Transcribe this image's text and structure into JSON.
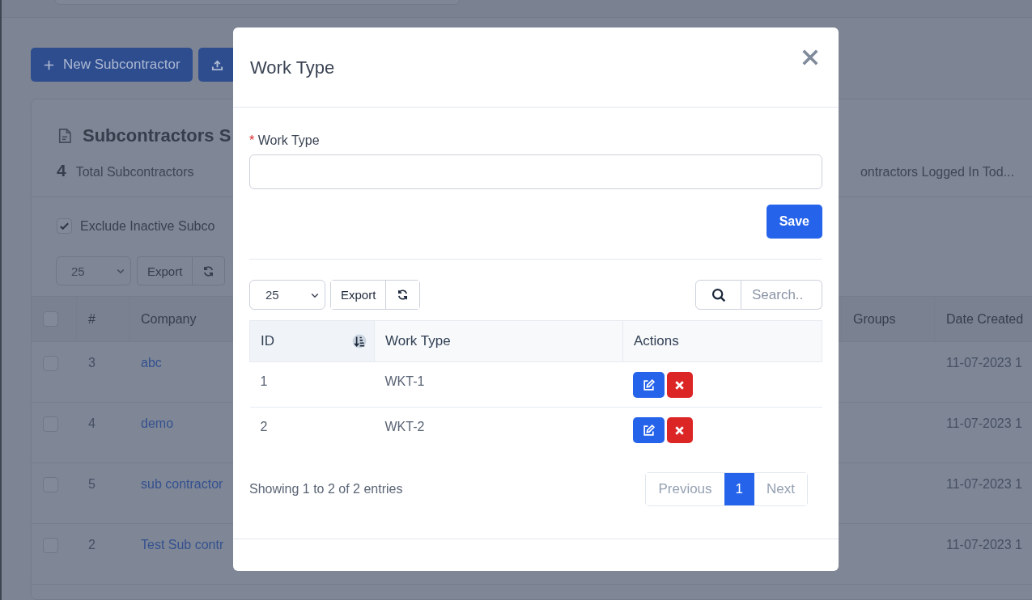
{
  "background_page": {
    "toolbar_buttons": [
      {
        "kind": "add",
        "label": "New Subcontractor"
      },
      {
        "kind": "upload"
      }
    ],
    "summary": {
      "title": "Subcontractors S",
      "total": {
        "count": "4",
        "label": "Total Subcontractors"
      },
      "other_stat": "ontractors Logged In Tod..."
    },
    "filter": {
      "label": "Exclude Inactive Subco",
      "checked": true
    },
    "page_size": "25",
    "export": "Export",
    "table": {
      "select_all": false,
      "columns": [
        "#",
        "Company",
        "Groups",
        "Date Created"
      ],
      "rows": [
        {
          "checked": false,
          "number": "3",
          "company": "abc",
          "date_created": "11-07-2023 1"
        },
        {
          "checked": false,
          "number": "4",
          "company": "demo",
          "date_created": "11-07-2023 1"
        },
        {
          "checked": false,
          "number": "5",
          "company": "sub contractor",
          "date_created": "11-07-2023 1"
        },
        {
          "checked": false,
          "number": "2",
          "company": "Test Sub contr",
          "date_created": "11-07-2023 1"
        }
      ]
    }
  },
  "modal": {
    "title": "Work Type",
    "field": {
      "required_mark": "*",
      "label": "Work Type"
    },
    "save": "Save",
    "page_size": "25",
    "export": "Export",
    "search": {
      "placeholder": "Search.."
    },
    "table": {
      "columns": [
        {
          "label": "ID",
          "sorted": true
        },
        {
          "label": "Work Type",
          "sorted": false
        },
        {
          "label": "Actions",
          "sorted": false
        }
      ],
      "rows": [
        {
          "id": "1",
          "work_type": "WKT-1"
        },
        {
          "id": "2",
          "work_type": "WKT-2"
        }
      ]
    },
    "info": "Showing 1 to 2 of 2 entries",
    "pagination": {
      "previous": {
        "label": "Previous",
        "disabled": true
      },
      "pages": [
        {
          "label": "1",
          "selected": true
        }
      ],
      "next": {
        "label": "Next",
        "disabled": true
      }
    }
  }
}
